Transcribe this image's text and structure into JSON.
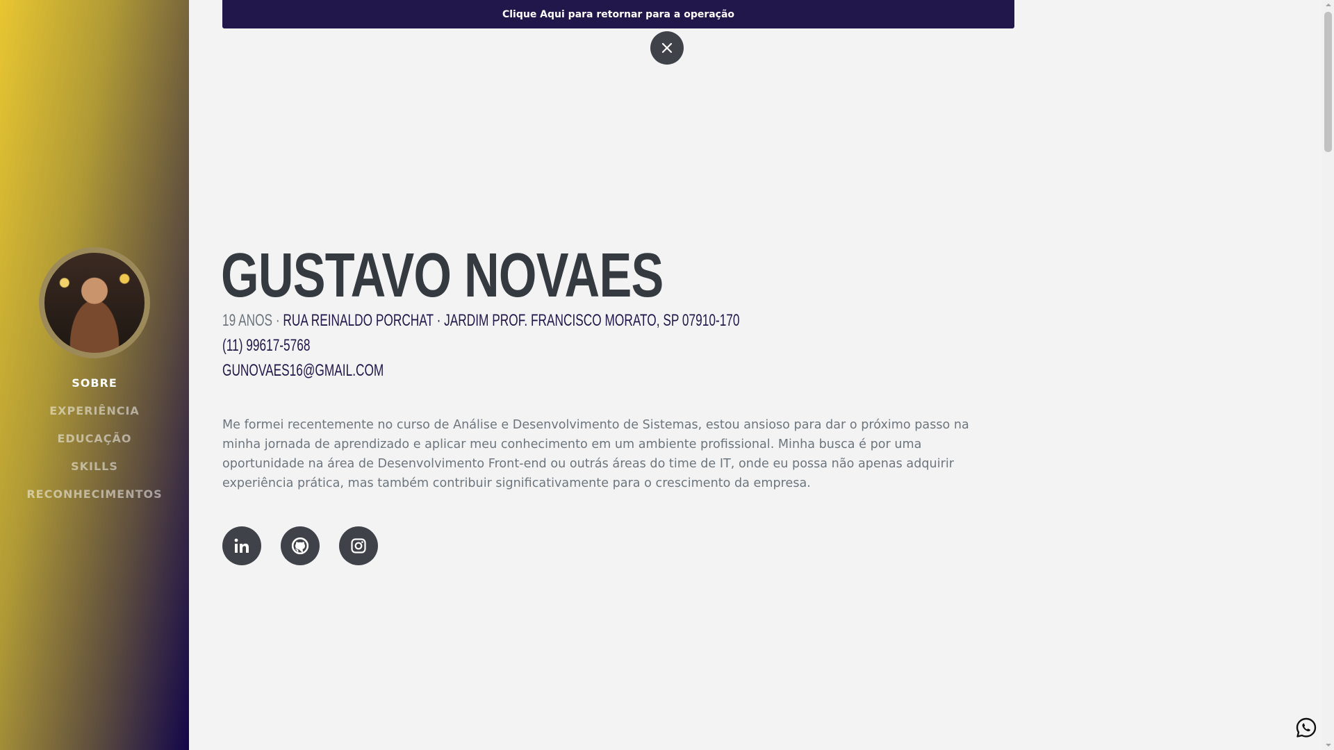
{
  "banner": {
    "label": "Clique Aqui para retornar para a operação"
  },
  "nav": {
    "items": [
      {
        "label": "SOBRE",
        "active": true
      },
      {
        "label": "EXPERIÊNCIA"
      },
      {
        "label": "EDUCAÇÃO"
      },
      {
        "label": "SKILLS"
      },
      {
        "label": "RECONHECIMENTOS"
      }
    ]
  },
  "profile": {
    "name": "GUSTAVO NOVAES",
    "age": "19 ANOS",
    "separator": "·",
    "address": "RUA REINALDO PORCHAT · JARDIM PROF. FRANCISCO MORATO, SP 07910-170",
    "phone": "(11) 99617-5768",
    "email": "GUNOVAES16@GMAIL.COM",
    "about": "Me formei recentemente no curso de Análise e Desenvolvimento de Sistemas, estou ansioso para dar o próximo passo na minha jornada de aprendizado e aplicar meu conhecimento em um ambiente profissional. Minha busca é por uma oportunidade na área de Desenvolvimento Front-end ou outrás áreas do time de IT, onde eu possa não apenas adquirir experiência prática, mas também contribuir significativamente para o crescimento da empresa."
  },
  "socials": [
    "linkedin-icon",
    "github-icon",
    "instagram-icon"
  ],
  "colors": {
    "banner": "#22174a",
    "name": "#343a40",
    "text": "#6c757d",
    "button": "#3f4349",
    "sidebar_start": "#e8c631",
    "sidebar_end": "#12064a"
  }
}
